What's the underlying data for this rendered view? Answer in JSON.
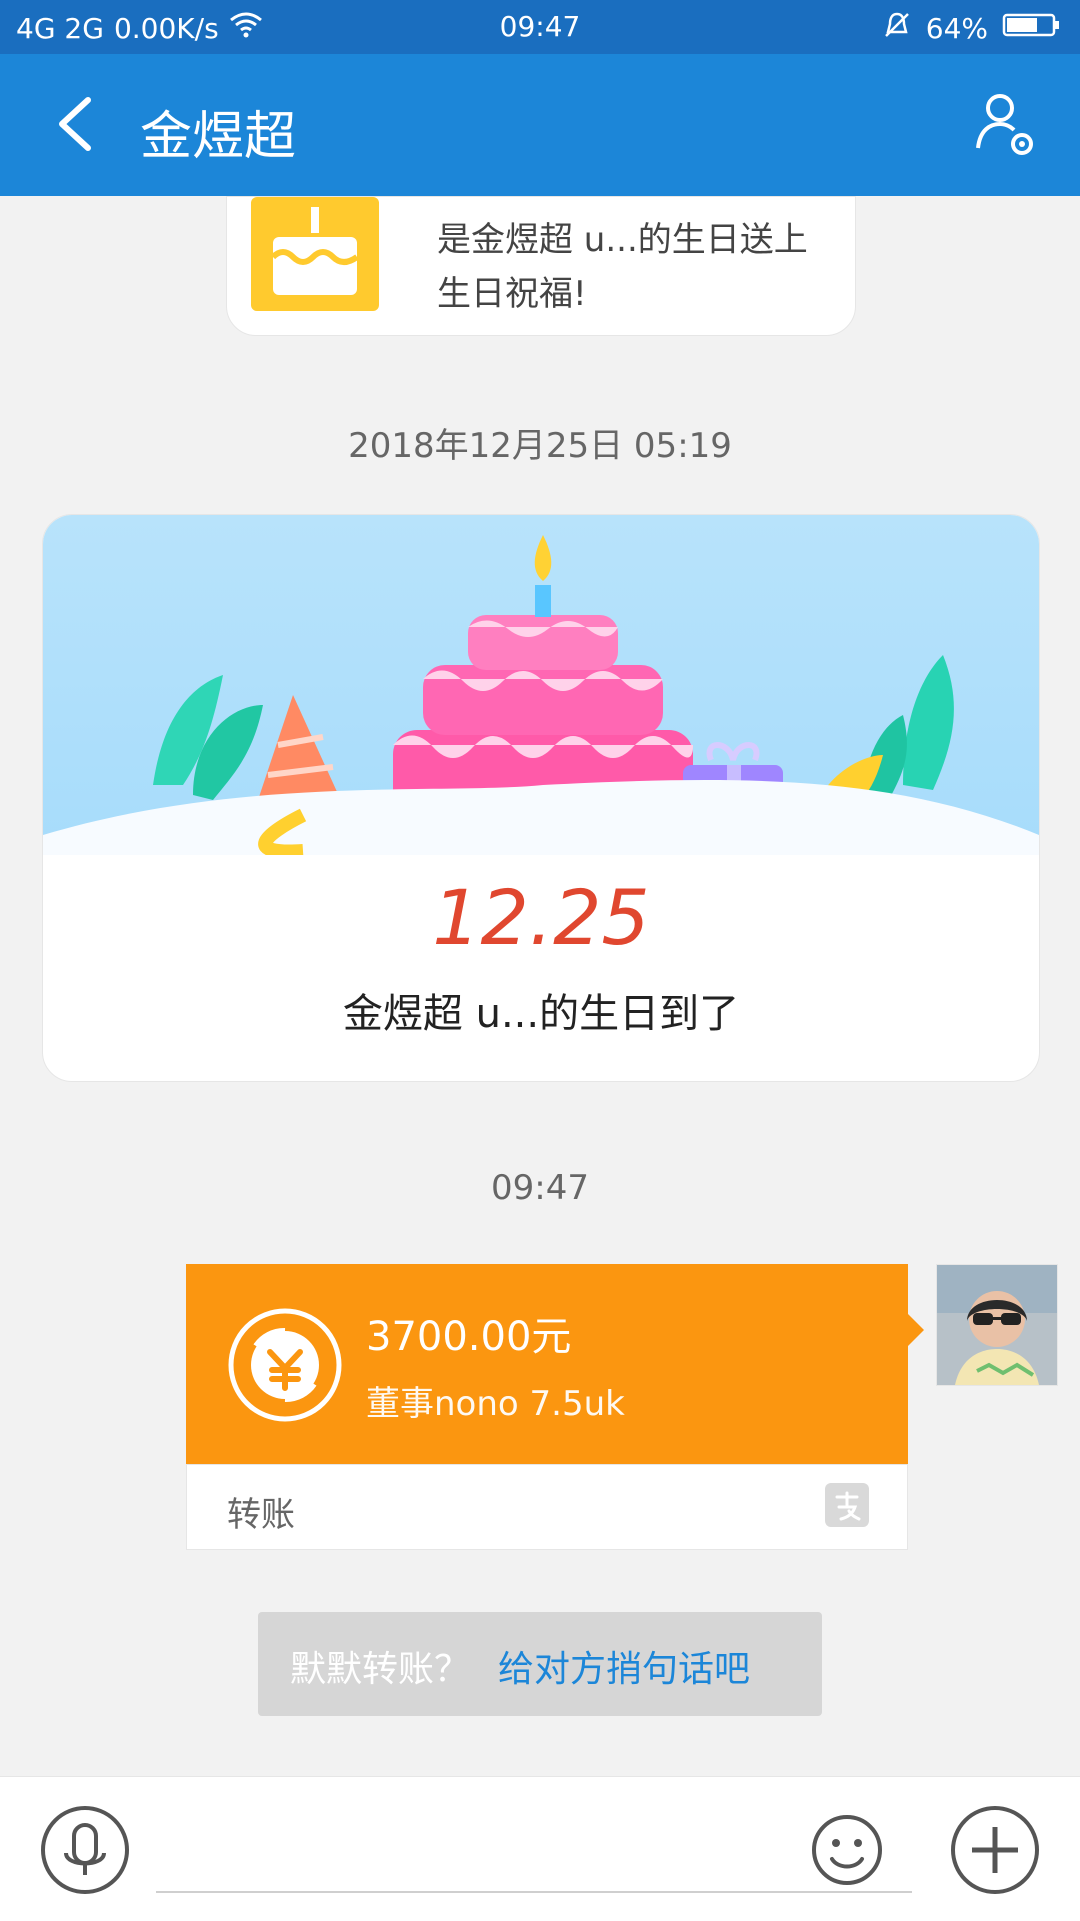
{
  "status_bar": {
    "network": "4G 2G",
    "speed": "0.00K/s",
    "time": "09:47",
    "battery": "64%"
  },
  "header": {
    "title": "金煜超"
  },
  "messages": {
    "birthday_card": {
      "text": "是金煜超 u...的生日送上生日祝福!"
    },
    "timestamp_1": "2018年12月25日 05:19",
    "birthday_banner": {
      "date": "12.25",
      "text": "金煜超 u...的生日到了"
    },
    "timestamp_2": "09:47",
    "transfer": {
      "amount": "3700.00元",
      "memo": "董事nono 7.5uk",
      "label": "转账"
    },
    "hint": {
      "gray": "默默转账？",
      "blue": "给对方捎句话吧"
    }
  },
  "icons": {
    "back": "back-icon",
    "profile_settings": "profile-settings-icon",
    "mic": "mic-icon",
    "emoji": "emoji-icon",
    "plus": "plus-icon",
    "transfer": "transfer-yuan-icon",
    "alipay": "alipay-icon"
  },
  "colors": {
    "header_bg": "#1c86d8",
    "status_bg": "#1a6ebf",
    "transfer_orange": "#fb9610",
    "birthday_yellow": "#ffca2e",
    "date_red": "#e0472f"
  }
}
